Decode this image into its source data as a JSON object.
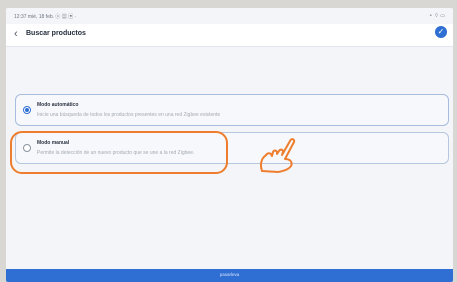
{
  "status_bar": {
    "left_text": "12:37 mié, 18 feb. ⓧ ▦ ▣ ·",
    "right_text": "⚬ ⌔ ▭"
  },
  "header": {
    "back_glyph": "‹",
    "title": "Buscar productos",
    "confirm_glyph": "✓"
  },
  "options": [
    {
      "title": "Modo automático",
      "description": "Inicie una búsqueda de todos los productos presentes en una red Zigbee existente",
      "selected": true
    },
    {
      "title": "Modo manual",
      "description": "Permite la detección de un nuevo producto que se une a la red Zigbee.",
      "selected": false
    }
  ],
  "footer": {
    "label": "pasarleva"
  },
  "colors": {
    "accent": "#2f6fd3",
    "annotation": "#ee7d2d"
  },
  "icons": [
    "chevron-left-icon",
    "check-icon",
    "hand-pointer-icon"
  ]
}
